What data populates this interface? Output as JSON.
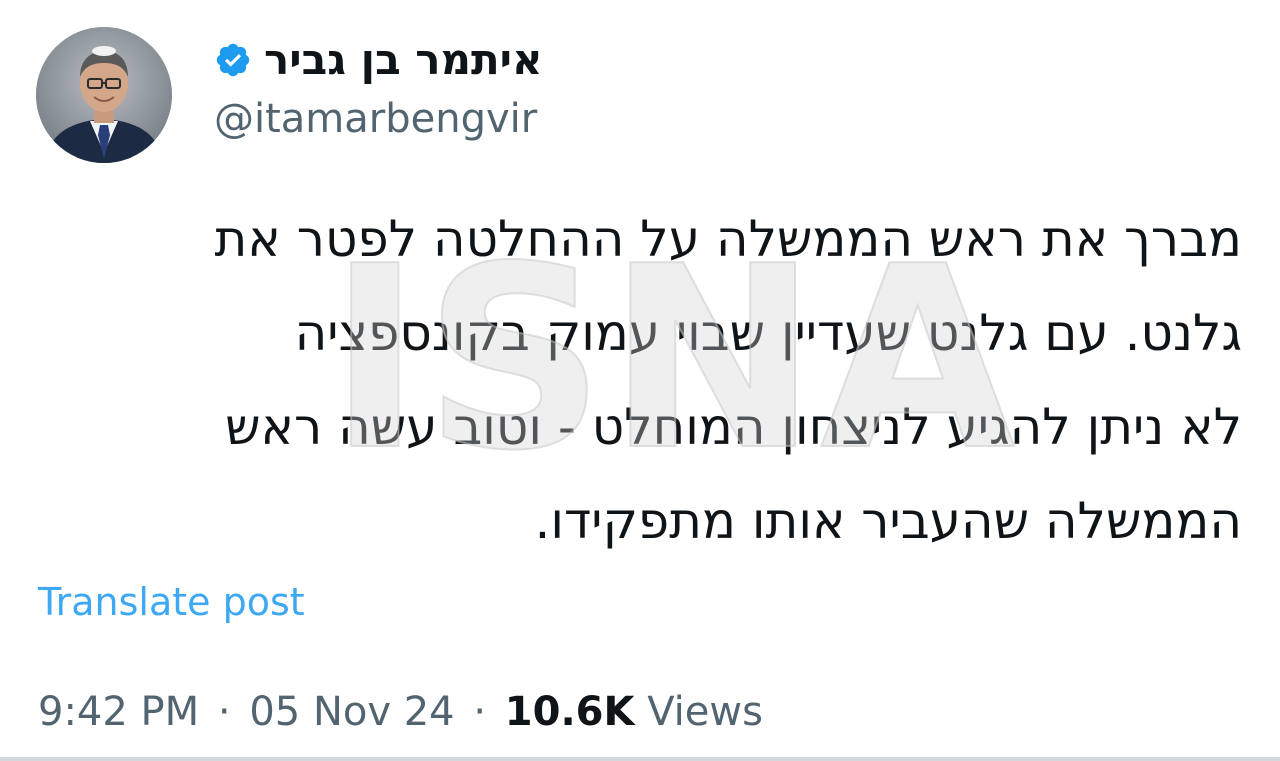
{
  "author": {
    "display_name": "איתמר בן גביר",
    "handle": "@itamarbengvir",
    "verified_icon": "verified-badge-icon",
    "avatar_icon": "profile-photo"
  },
  "post": {
    "text_lines": [
      "מברך את ראש הממשלה על ההחלטה לפטר את",
      "גלנט. עם גלנט שעדיין שבוי עמוק בקונספציה",
      "לא ניתן להגיע לניצחון המוחלט - וטוב עשה ראש",
      "הממשלה שהעביר אותו מתפקידו."
    ],
    "translate_label": "Translate post"
  },
  "meta": {
    "time": "9:42 PM",
    "separator": "·",
    "date": "05 Nov 24",
    "views_count": "10.6K",
    "views_label": "Views"
  },
  "watermark": {
    "text": "ISNA"
  },
  "colors": {
    "link": "#1d9bf0",
    "verified": "#1d9bf0",
    "secondary_text": "#536471",
    "primary_text": "#0f1419"
  }
}
